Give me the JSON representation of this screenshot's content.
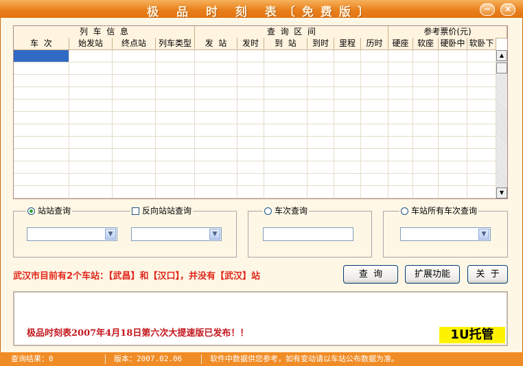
{
  "window": {
    "title": "极 品 时 刻 表〔免费版〕",
    "minimize_symbol": "−",
    "close_symbol": "×"
  },
  "grid": {
    "group_headers": [
      "列  车  信  息",
      "查  询  区  间",
      "参考票价(元)"
    ],
    "columns": [
      "车  次",
      "始发站",
      "终点站",
      "列车类型",
      "发  站",
      "发时",
      "到  站",
      "到时",
      "里程",
      "历时",
      "硬座",
      "软座",
      "硬卧中",
      "软卧下"
    ],
    "rows": []
  },
  "queries": {
    "station": {
      "label": "站站查询",
      "selected": true,
      "from": "",
      "to": ""
    },
    "reverse": {
      "label": "反向站站查询",
      "checked": false
    },
    "train": {
      "label": "车次查询",
      "selected": false,
      "value": ""
    },
    "all_trains": {
      "label": "车站所有车次查询",
      "selected": false,
      "value": ""
    }
  },
  "notice": "武汉市目前有2个车站：【武昌】和【汉口】，并没有【武汉】站",
  "buttons": {
    "query": "查  询",
    "extend": "扩展功能",
    "about": "关  于"
  },
  "message": "极品时刻表2007年4月18日第六次大提速版已发布！！",
  "badge": "1U托管",
  "status": {
    "results": "查询结果：0",
    "version": "版本：2007.02.06",
    "disclaimer": "软件中数据供您参考，如有变动请以车站公布数据为准。"
  },
  "colors": {
    "accent": "#E9801D",
    "notice_red": "#E0261A",
    "background": "#FEF7E6"
  }
}
